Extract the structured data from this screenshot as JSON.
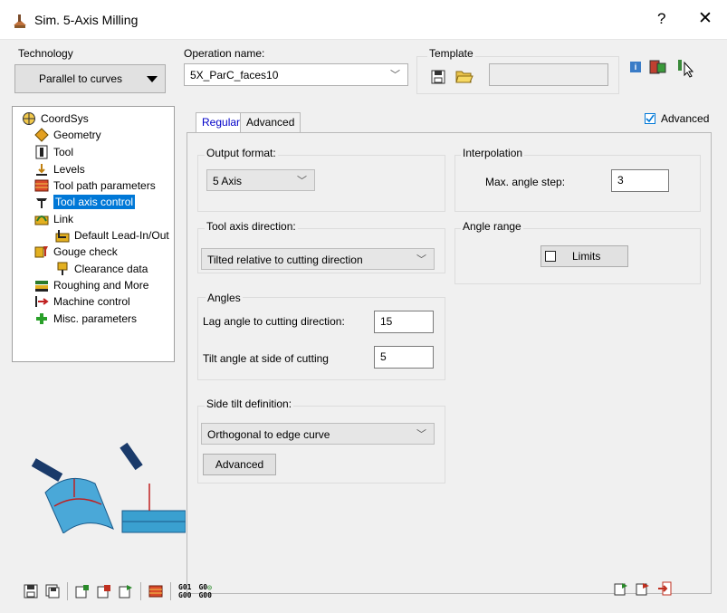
{
  "window": {
    "title": "Sim. 5-Axis Milling",
    "help_label": "?",
    "close_label": "✕"
  },
  "technology": {
    "label": "Technology",
    "value": "Parallel to curves"
  },
  "operation": {
    "label": "Operation name:",
    "value": "5X_ParC_faces10"
  },
  "template": {
    "label": "Template",
    "value": ""
  },
  "tree": {
    "items": [
      {
        "label": "CoordSys",
        "icon": "coordsys-icon"
      },
      {
        "label": "Geometry",
        "icon": "geometry-icon"
      },
      {
        "label": "Tool",
        "icon": "tool-icon"
      },
      {
        "label": "Levels",
        "icon": "levels-icon"
      },
      {
        "label": "Tool path parameters",
        "icon": "toolpath-icon"
      },
      {
        "label": "Tool axis control",
        "icon": "tool-axis-icon",
        "selected": true
      },
      {
        "label": "Link",
        "icon": "link-icon"
      },
      {
        "label": "Default Lead-In/Out",
        "icon": "lead-in-out-icon"
      },
      {
        "label": "Gouge check",
        "icon": "gouge-check-icon"
      },
      {
        "label": "Clearance data",
        "icon": "clearance-icon"
      },
      {
        "label": "Roughing and More",
        "icon": "roughing-icon"
      },
      {
        "label": "Machine control",
        "icon": "machine-control-icon"
      },
      {
        "label": "Misc. parameters",
        "icon": "misc-params-icon"
      }
    ]
  },
  "tabs": {
    "regular": "Regular",
    "advanced": "Advanced"
  },
  "advanced_checkbox": {
    "label": "Advanced",
    "checked": true
  },
  "output_format": {
    "label": "Output format:",
    "value": "5 Axis"
  },
  "interpolation": {
    "label": "Interpolation",
    "step_label": "Max. angle step:",
    "step_value": "3"
  },
  "tool_axis_direction": {
    "label": "Tool axis direction:",
    "value": "Tilted relative to cutting direction"
  },
  "angle_range": {
    "label": "Angle range",
    "limits_label": "Limits"
  },
  "angles": {
    "label": "Angles",
    "lag_label": "Lag angle to cutting direction:",
    "lag_value": "15",
    "tilt_label": "Tilt angle at side of cutting",
    "tilt_value": "5"
  },
  "side_tilt": {
    "label": "Side tilt definition:",
    "value": "Orthogonal to edge curve",
    "advanced_button": "Advanced"
  },
  "bottom_toolbar": {
    "g01_label": "G01",
    "g00_label": "G00",
    "g00b_label": "G00",
    "g0_label": "G0"
  },
  "colors": {
    "accent": "#0078d7",
    "tab_active_text": "#0000c8",
    "background": "#f0f0f0"
  }
}
